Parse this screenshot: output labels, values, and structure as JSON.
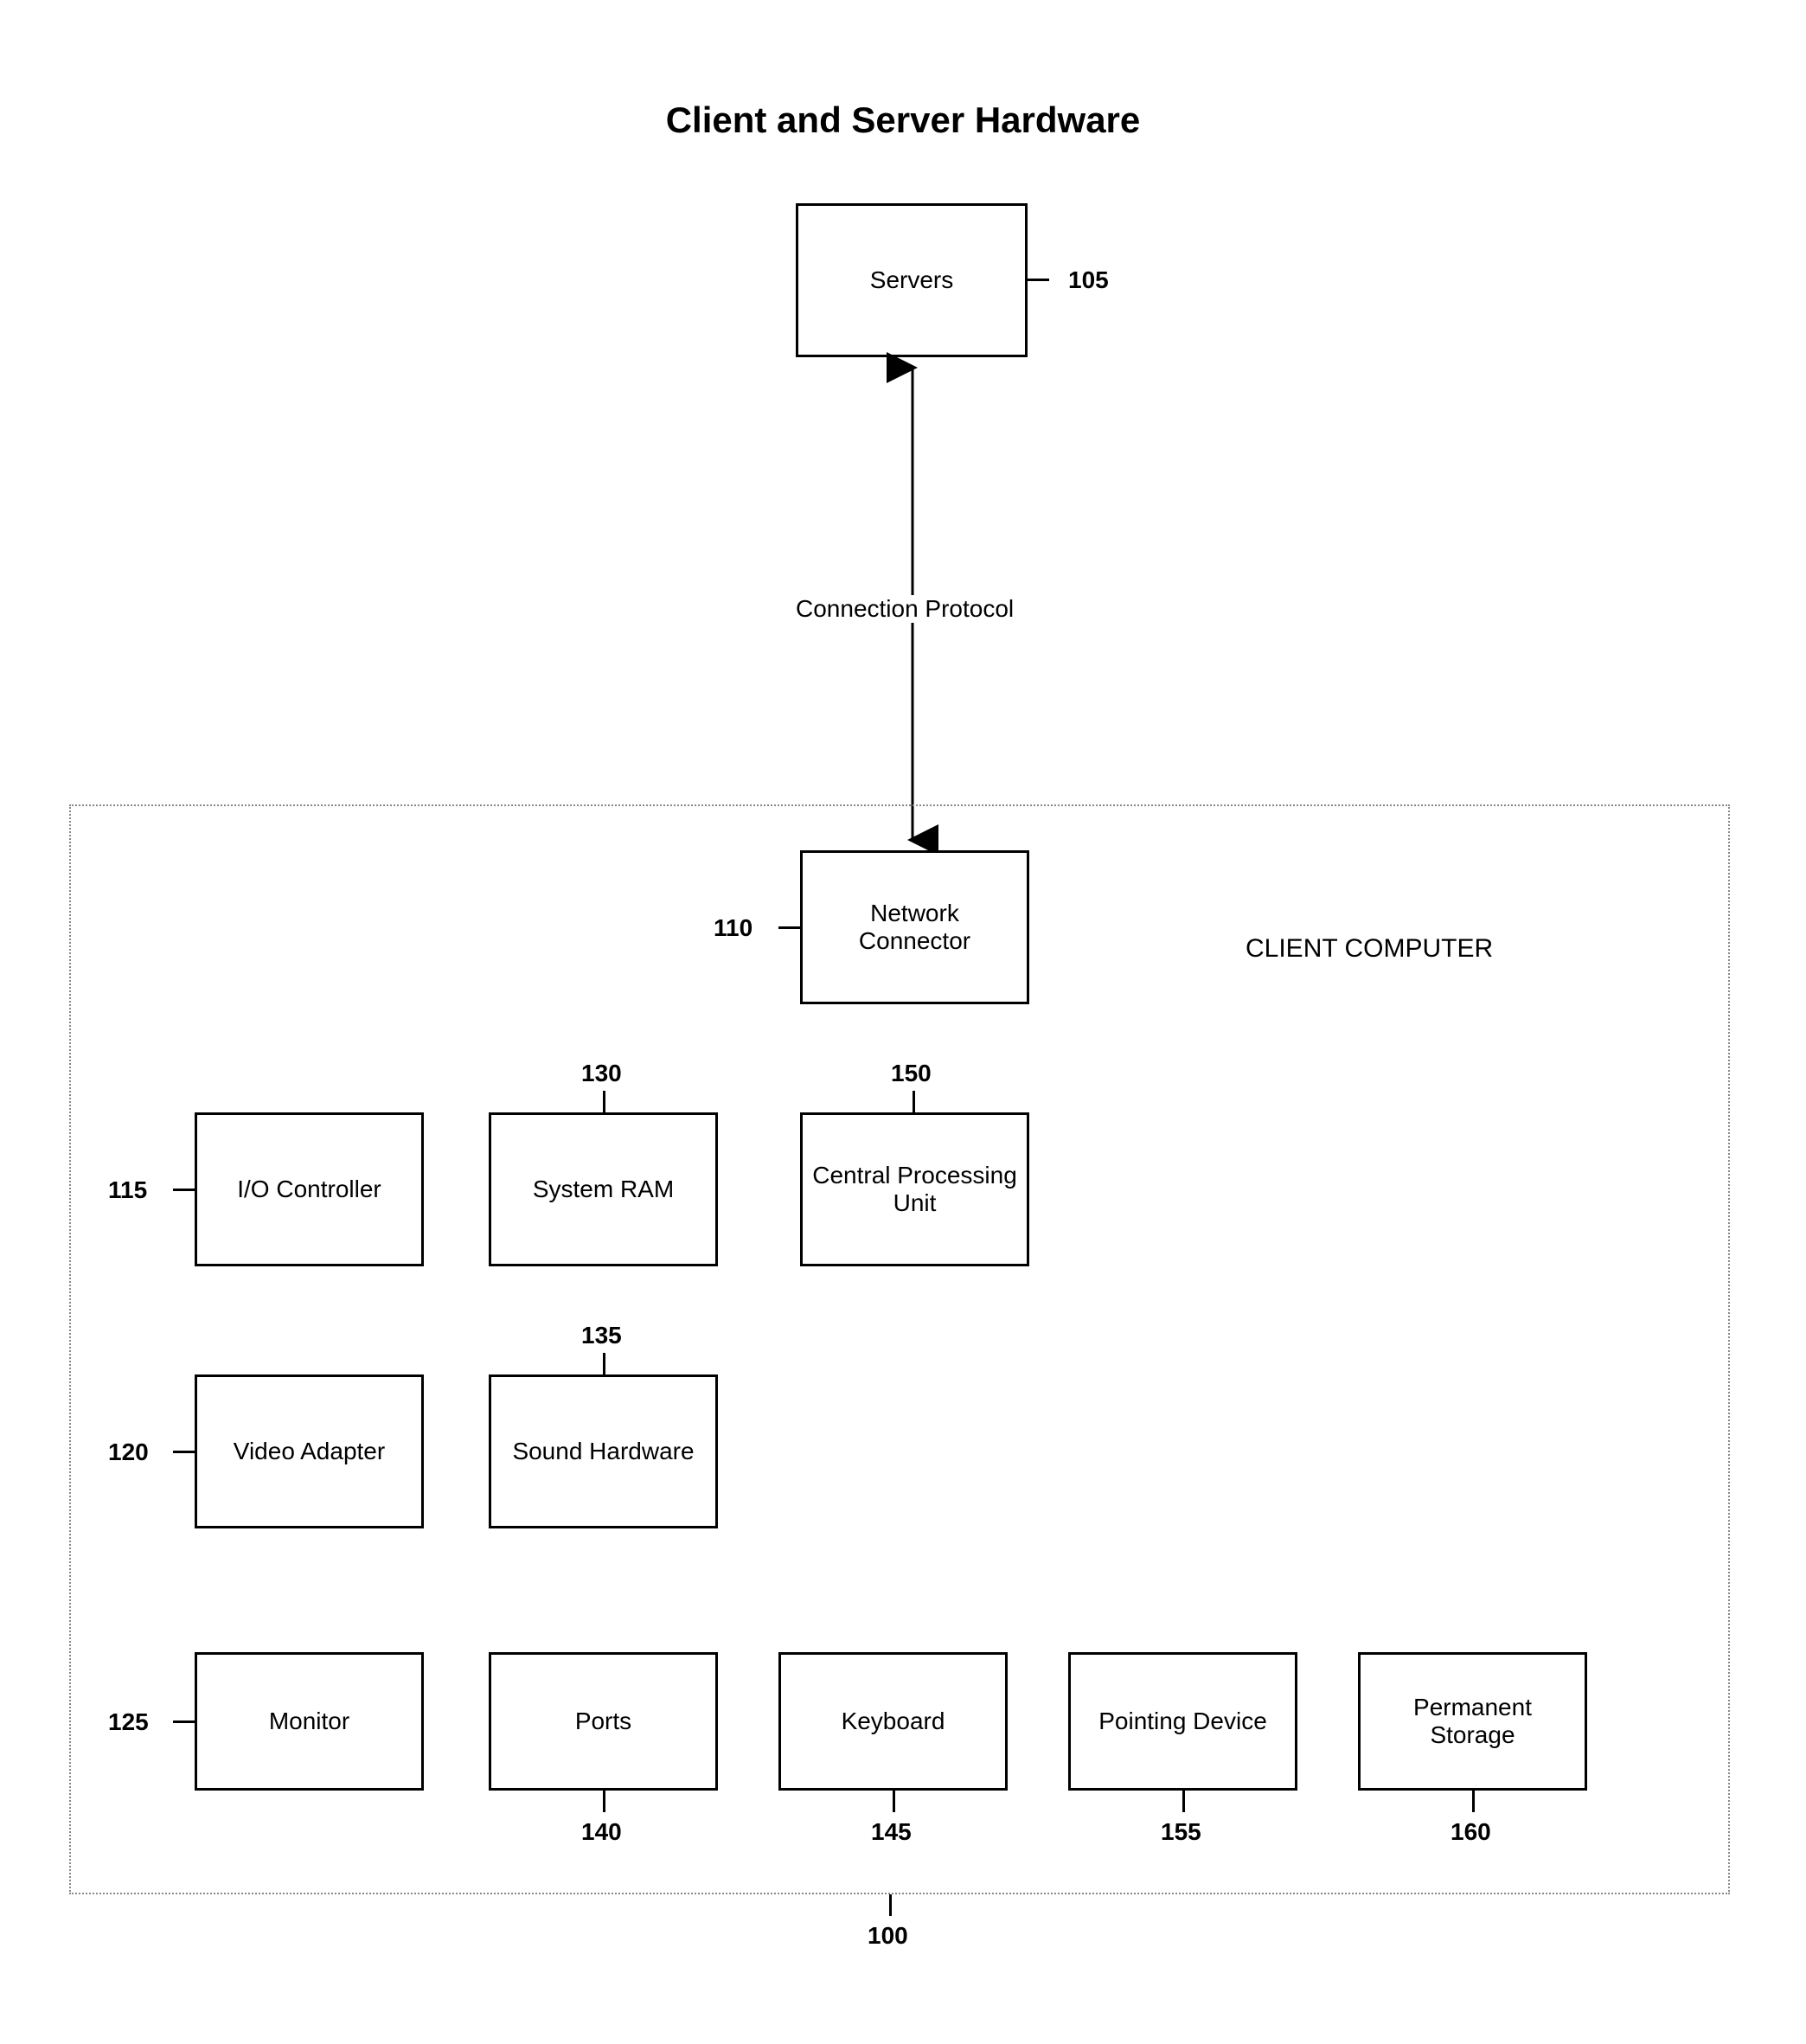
{
  "title": "Client and Server Hardware",
  "connection_label": "Connection Protocol",
  "client_label": "CLIENT COMPUTER",
  "boxes": {
    "servers": {
      "label": "Servers",
      "ref": "105"
    },
    "network_connector": {
      "label": "Network Connector",
      "ref": "110"
    },
    "io_controller": {
      "label": "I/O Controller",
      "ref": "115"
    },
    "system_ram": {
      "label": "System RAM",
      "ref": "130"
    },
    "cpu": {
      "label": "Central Processing Unit",
      "ref": "150"
    },
    "video_adapter": {
      "label": "Video Adapter",
      "ref": "120"
    },
    "sound_hardware": {
      "label": "Sound Hardware",
      "ref": "135"
    },
    "monitor": {
      "label": "Monitor",
      "ref": "125"
    },
    "ports": {
      "label": "Ports",
      "ref": "140"
    },
    "keyboard": {
      "label": "Keyboard",
      "ref": "145"
    },
    "pointing_device": {
      "label": "Pointing Device",
      "ref": "155"
    },
    "permanent_storage": {
      "label": "Permanent Storage",
      "ref": "160"
    },
    "client_frame": {
      "ref": "100"
    }
  }
}
